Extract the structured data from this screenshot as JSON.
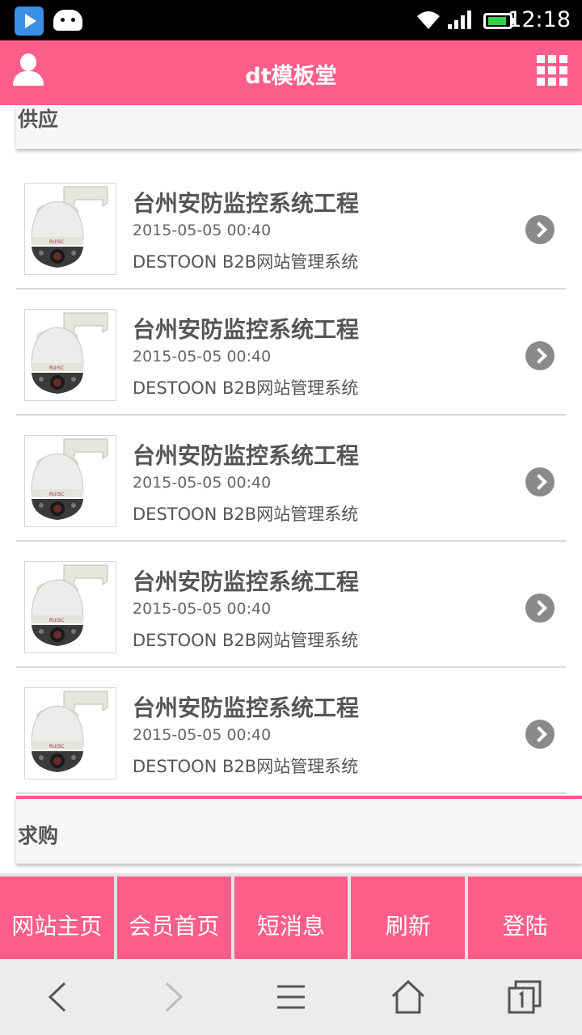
{
  "status_bar": {
    "time": "12:18"
  },
  "header": {
    "title": "dt模板堂"
  },
  "supply_section": {
    "label": "供应"
  },
  "demand_section": {
    "label": "求购"
  },
  "supply_items": [
    {
      "name": "台州安防监控系统工程",
      "date": "2015-05-05 00:40",
      "description": "DESTOON B2B网站管理系统"
    },
    {
      "name": "台州安防监控系统工程",
      "date": "2015-05-05 00:40",
      "description": "DESTOON B2B网站管理系统"
    },
    {
      "name": "台州安防监控系统工程",
      "date": "2015-05-05 00:40",
      "description": "DESTOON B2B网站管理系统"
    },
    {
      "name": "台州安防监控系统工程",
      "date": "2015-05-05 00:40",
      "description": "DESTOON B2B网站管理系统"
    },
    {
      "name": "台州安防监控系统工程",
      "date": "2015-05-05 00:40",
      "description": "DESTOON B2B网站管理系统"
    }
  ],
  "bottom_nav": [
    "网站主页",
    "会员首页",
    "短消息",
    "刷新",
    "登陆"
  ],
  "colors": {
    "brand": "#ff5e8a",
    "arrow": "#8a8a8a"
  },
  "icons": {
    "status": [
      "video-app-icon",
      "android-icon",
      "wifi-icon",
      "signal-icon",
      "battery-icon"
    ],
    "header_left": "user-icon",
    "header_right": "grid-menu-icon",
    "item_thumb": "security-camera-image",
    "item_arrow": "chevron-right-icon",
    "browser": [
      "back-icon",
      "forward-icon",
      "menu-icon",
      "home-icon",
      "tabs-icon"
    ]
  }
}
